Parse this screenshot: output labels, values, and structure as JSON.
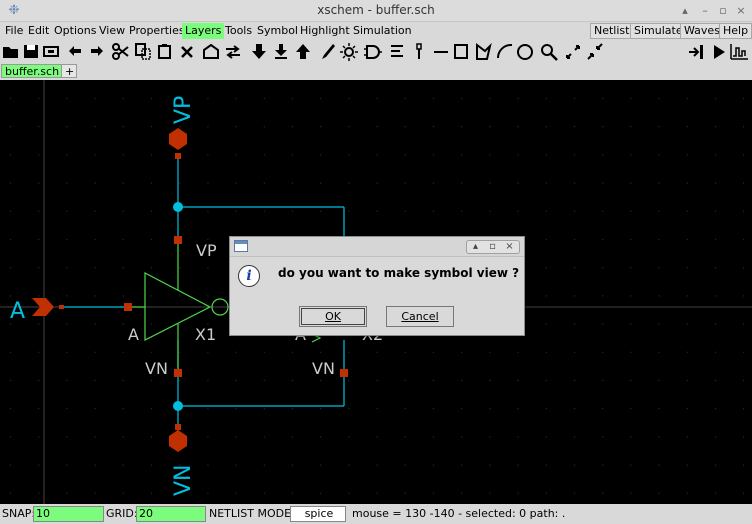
{
  "window": {
    "title": "xschem - buffer.sch",
    "app_icon": "xschem-app-icon"
  },
  "menubar": {
    "items": [
      "File",
      "Edit",
      "Options",
      "View",
      "Properties",
      "Layers",
      "Tools",
      "Symbol",
      "Highlight",
      "Simulation"
    ],
    "active_item": "Layers",
    "right_buttons": [
      "Netlist",
      "Simulate",
      "Waves",
      "Help"
    ]
  },
  "toolbar": {
    "icons": [
      "open-icon",
      "save-icon",
      "reload-icon",
      "undo-icon",
      "redo-icon",
      "cut-icon",
      "copy-icon",
      "paste-icon",
      "delete-icon",
      "new-window-icon",
      "swap-icon",
      "push-icon",
      "pop-icon",
      "up-icon",
      "brush-icon",
      "sun-icon",
      "gate-icon",
      "label-icon",
      "pin-icon",
      "line-icon",
      "rect-icon",
      "poly-icon",
      "arc-icon",
      "circle-icon",
      "zoom-icon",
      "zoom-in-icon",
      "zoom-out-icon",
      "netlist-icon",
      "simulate-icon",
      "waves-icon"
    ]
  },
  "tabs": {
    "active": "buffer.sch",
    "add": "+"
  },
  "schematic": {
    "labels": {
      "pin_a": "A",
      "pin_vp": "VP",
      "pin_vn": "VN",
      "x1_vp": "VP",
      "x1_vn": "VN",
      "x1_a": "A",
      "x1_name": "X1",
      "x2_a": "A",
      "x2_vn": "VN",
      "x2_name": "X2"
    },
    "colors": {
      "background": "#000000",
      "wire": "#00c0e0",
      "pin": "#c03000",
      "symbol": "#4ed84e",
      "label_text": "#cccccc",
      "grid": "#3a3a3a"
    }
  },
  "dialog": {
    "message": "do you want to make symbol view ?",
    "ok_label": "OK",
    "cancel_label": "Cancel",
    "controls": [
      "▴",
      "▫",
      "×"
    ]
  },
  "statusbar": {
    "snap_label": "SNAP:",
    "snap_value": "10",
    "grid_label": "GRID:",
    "grid_value": "20",
    "netlist_mode_label": "NETLIST MODE:",
    "netlist_mode_value": "spice",
    "mouse_info": "mouse = 130 -140 - selected: 0 path: ."
  }
}
